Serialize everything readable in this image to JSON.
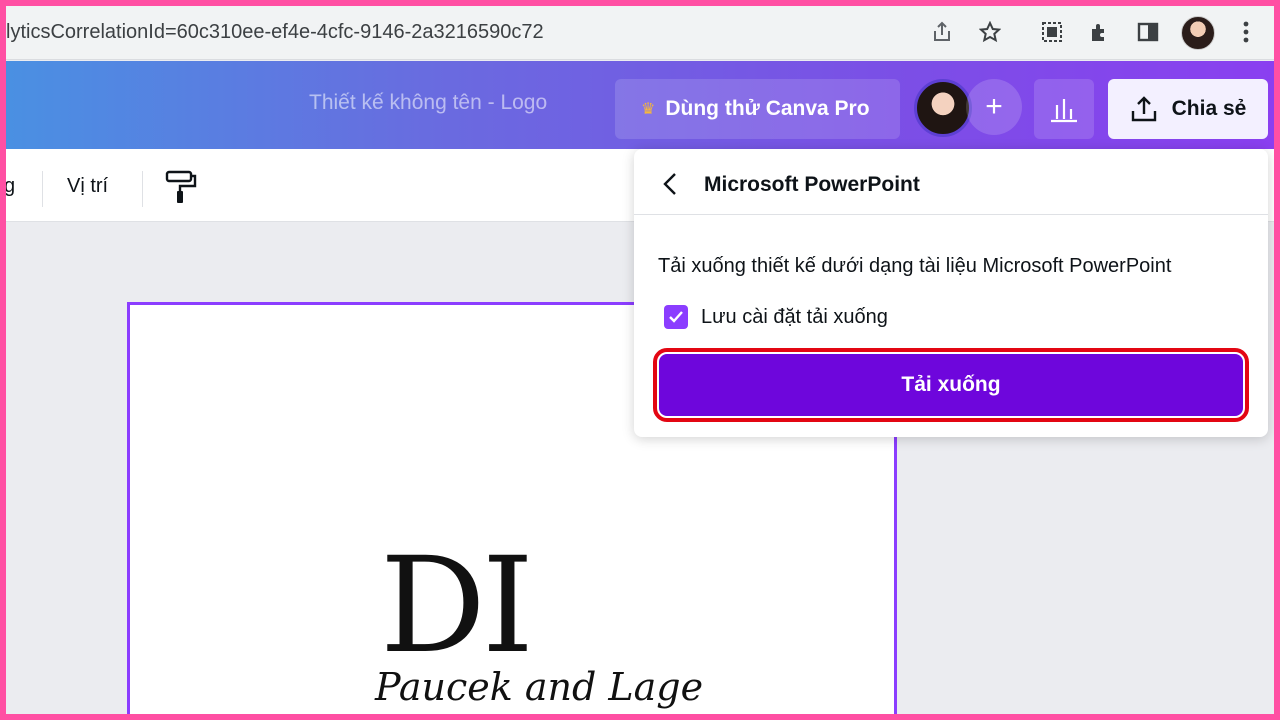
{
  "browser": {
    "url_text": "lyticsCorrelationId=60c310ee-ef4e-4cfc-9146-2a3216590c72",
    "icons": [
      "share-icon",
      "star-icon",
      "screenshot-icon",
      "extensions-icon",
      "sidepanel-icon",
      "profile-avatar",
      "more-icon"
    ]
  },
  "header": {
    "design_title": "Thiết kế không tên - Logo",
    "try_pro_label": "Dùng thử Canva Pro",
    "share_label": "Chia sẻ"
  },
  "toolbar": {
    "partial_label": "g",
    "position_label": "Vị trí"
  },
  "canvas": {
    "monogram": "DI",
    "script_text": "Paucek and Lage"
  },
  "panel": {
    "title": "Microsoft PowerPoint",
    "description": "Tải xuống thiết kế dưới dạng tài liệu Microsoft PowerPoint",
    "checkbox_label": "Lưu cài đặt tải xuống",
    "checkbox_checked": true,
    "download_label": "Tải xuống"
  },
  "colors": {
    "accent": "#8b3dff",
    "download_button": "#6e06dc",
    "highlight": "#e30613",
    "outer_border": "#ff4fa3"
  }
}
